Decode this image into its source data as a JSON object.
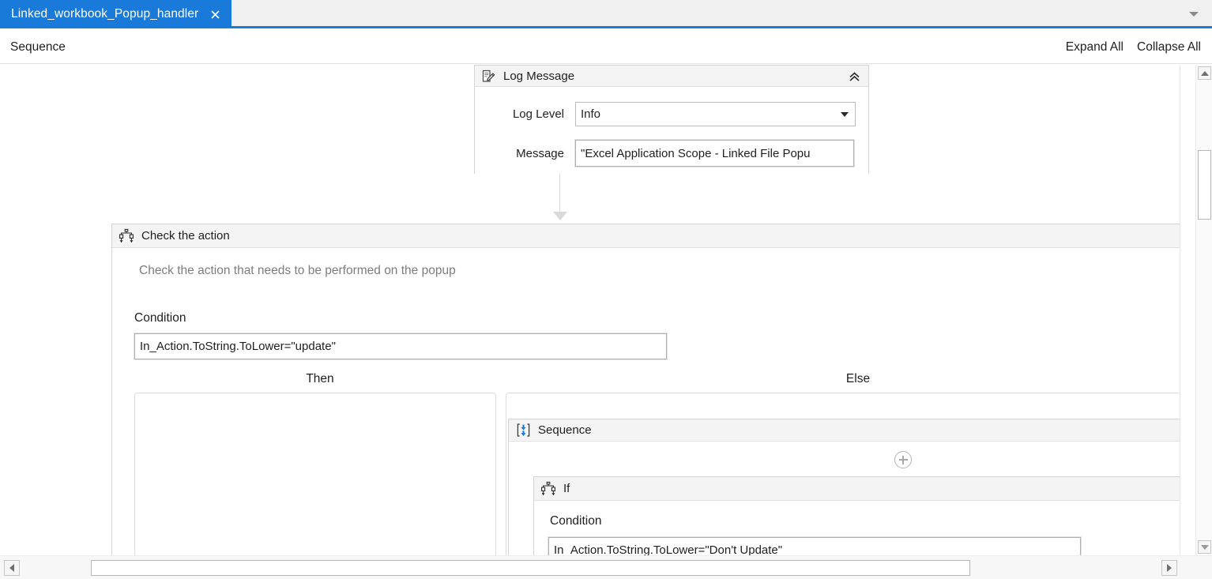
{
  "window": {
    "tab_title": "Linked_workbook_Popup_handler",
    "close_icon": "close-icon",
    "overflow_icon": "chevron-down-icon"
  },
  "breadcrumb": {
    "path": "Sequence",
    "expand_all": "Expand All",
    "collapse_all": "Collapse All"
  },
  "canvas": {
    "log_message": {
      "title": "Log Message",
      "icon": "log-message-icon",
      "collapse_icon": "chevron-double-up-icon",
      "fields": [
        {
          "label": "Log Level",
          "value": "Info",
          "type": "combobox"
        },
        {
          "label": "Message",
          "value": "\"Excel Application Scope - Linked File Popu",
          "type": "expression"
        }
      ]
    },
    "check_action": {
      "title": "Check the action",
      "icon": "if-decision-icon",
      "subtitle": "Check the action that needs to be performed on the popup",
      "condition_label": "Condition",
      "condition_value": "In_Action.ToString.ToLower=\"update\"",
      "then_label": "Then",
      "else_label": "Else",
      "else_body": {
        "sequence": {
          "title": "Sequence",
          "icon": "sequence-icon",
          "add_icon": "plus-circle-icon",
          "inner_if": {
            "title": "If",
            "icon": "if-decision-icon",
            "collapse_icon": "chevron-double-up-icon",
            "condition_label": "Condition",
            "condition_value": "In_Action.ToString.ToLower=\"Don't Update\""
          }
        }
      }
    }
  },
  "scrollbars": {
    "vertical": {
      "up_icon": "triangle-up-icon",
      "down_icon": "triangle-down-icon"
    },
    "horizontal": {
      "left_icon": "triangle-left-icon",
      "right_icon": "triangle-right-icon"
    }
  },
  "colors": {
    "accent": "#1a7ad9",
    "header_bg": "#f4f4f4",
    "border": "#d4d4d4",
    "muted_text": "#7d7d7d"
  }
}
